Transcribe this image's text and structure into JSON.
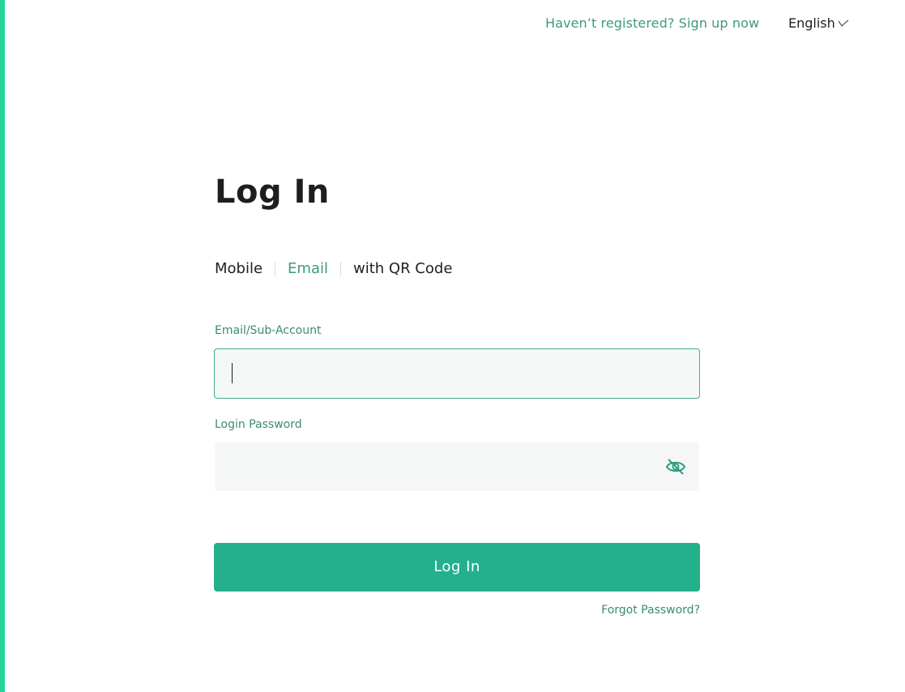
{
  "header": {
    "signup_link": "Haven’t registered? Sign up now",
    "language": "English",
    "language_icon": "chevron-down-icon"
  },
  "login": {
    "title": "Log In",
    "tabs": [
      {
        "label": "Mobile",
        "active": false
      },
      {
        "label": "Email",
        "active": true
      },
      {
        "label": "with QR Code",
        "active": false
      }
    ],
    "email_label": "Email/Sub-Account",
    "email_value": "",
    "password_label": "Login Password",
    "password_value": "",
    "password_toggle_icon": "eye-off-icon",
    "submit_label": "Log In",
    "forgot_password": "Forgot Password?"
  },
  "colors": {
    "accent": "#24af8d",
    "link": "#3d9a7d",
    "edge": "#26d39a",
    "input_background": "#f4f7f6"
  }
}
